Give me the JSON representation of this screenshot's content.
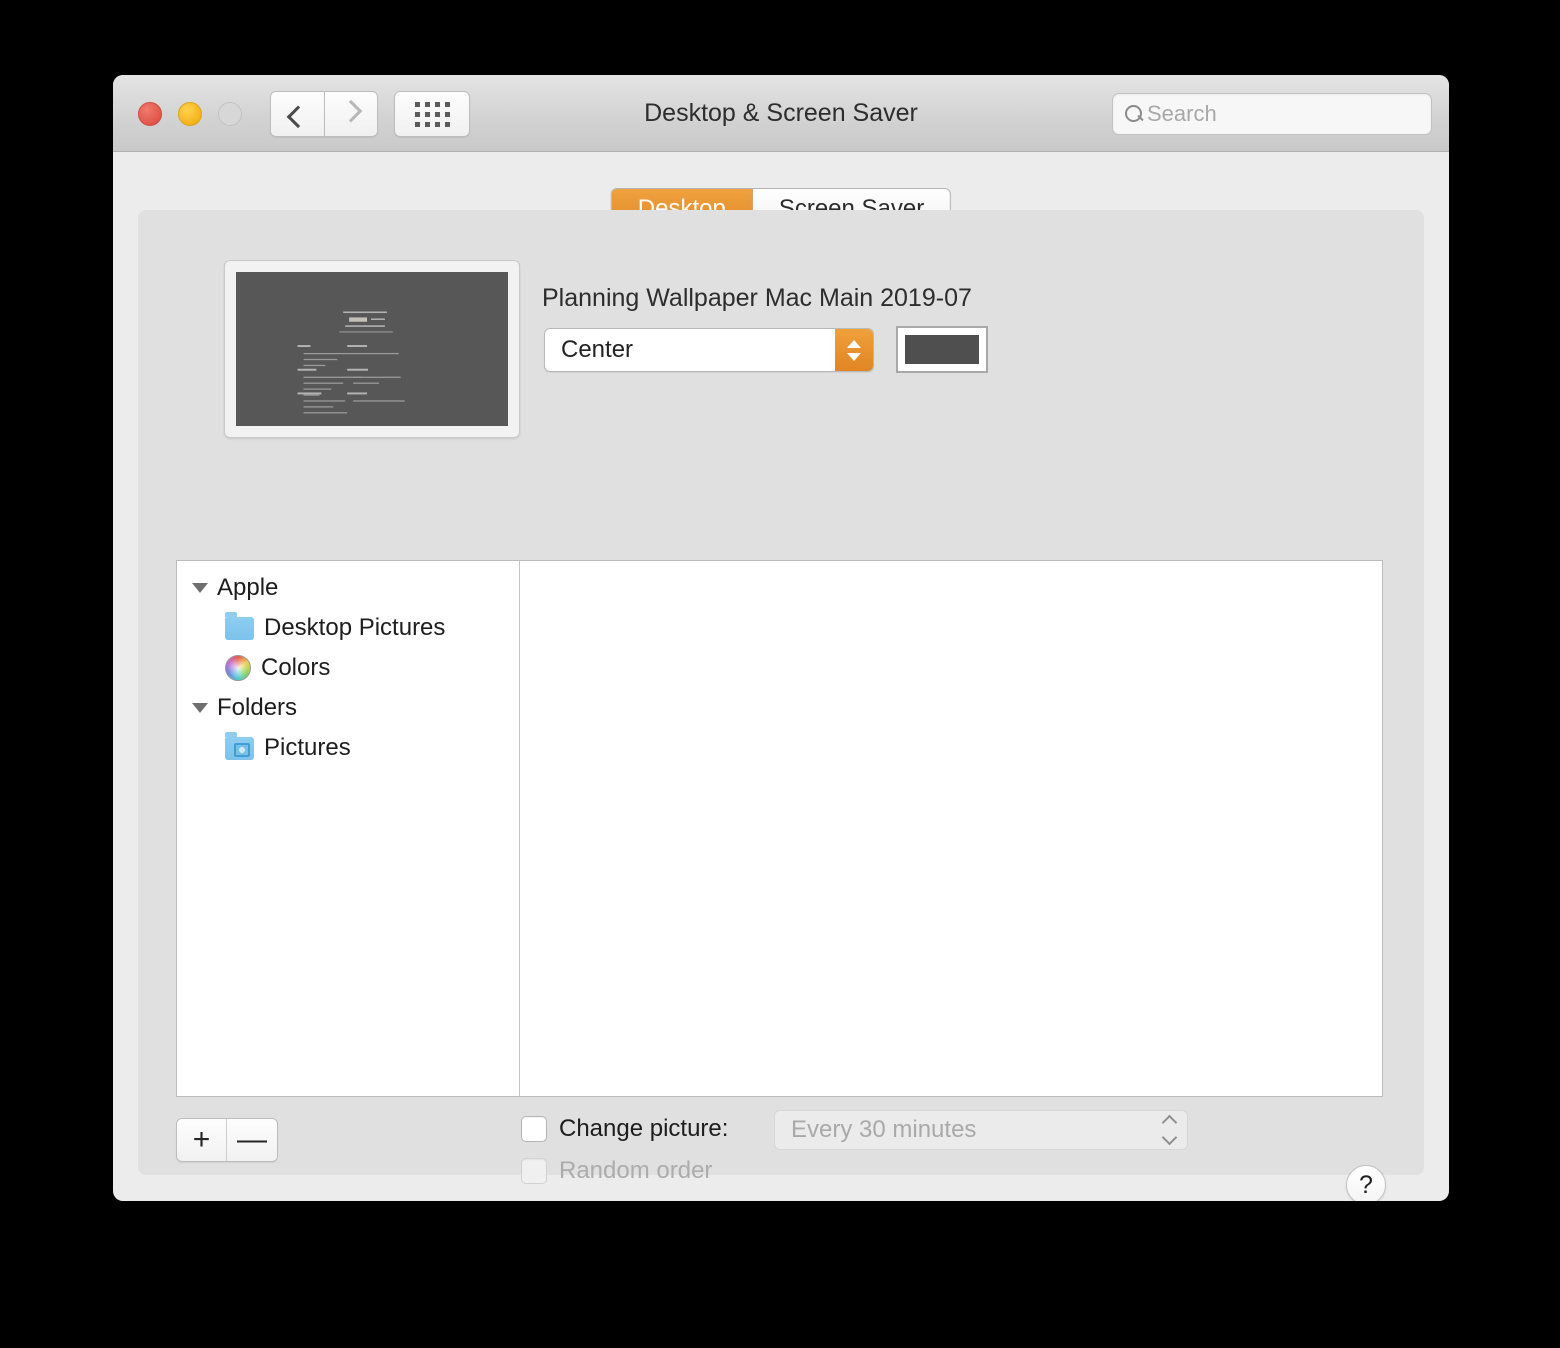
{
  "window": {
    "title": "Desktop & Screen Saver",
    "traffic_lights": {
      "close_color": "#e05245",
      "minimize_color": "#f3b018",
      "zoom_color": "#d7d7d7"
    }
  },
  "toolbar": {
    "back_icon": "chevron-left-icon",
    "forward_icon": "chevron-right-icon",
    "grid_icon": "grid-view-icon",
    "search": {
      "icon": "search-icon",
      "placeholder": "Search",
      "value": ""
    }
  },
  "tabs": [
    {
      "label": "Desktop",
      "active": true
    },
    {
      "label": "Screen Saver",
      "active": false
    }
  ],
  "accent_color": "#e2872a",
  "desktop": {
    "preview": {
      "name": "Planning Wallpaper Mac Main 2019-07",
      "background_color": "#575757"
    },
    "fill_popup": {
      "value": "Center",
      "stepper_icon": "stepper-updown-icon"
    },
    "color_well": {
      "name": "background-color-well",
      "color": "#4f4f4f"
    }
  },
  "sidebar": {
    "groups": [
      {
        "label": "Apple",
        "disclosure_icon": "disclosure-triangle-open-icon",
        "items": [
          {
            "label": "Desktop Pictures",
            "icon": "blue-folder-icon"
          },
          {
            "label": "Colors",
            "icon": "color-wheel-icon"
          }
        ]
      },
      {
        "label": "Folders",
        "disclosure_icon": "disclosure-triangle-open-icon",
        "items": [
          {
            "label": "Pictures",
            "icon": "pictures-folder-icon"
          }
        ]
      }
    ]
  },
  "bottom_bar": {
    "add_label": "+",
    "remove_label": "—",
    "change_picture": {
      "label": "Change picture:",
      "checked": false,
      "enabled": true
    },
    "interval": {
      "value": "Every 30 minutes",
      "enabled": false
    },
    "random_order": {
      "label": "Random order",
      "checked": false,
      "enabled": false
    },
    "help_label": "?"
  }
}
